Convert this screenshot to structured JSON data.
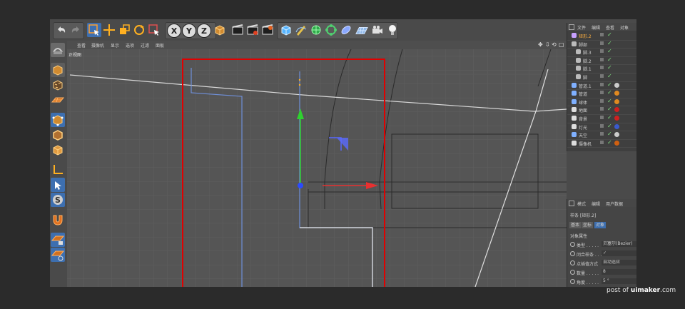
{
  "toolbar": {
    "undo_icon": "undo-icon",
    "redo_icon": "redo-icon",
    "x_label": "X",
    "y_label": "Y",
    "z_label": "Z"
  },
  "viewport": {
    "menu": [
      "查看",
      "摄像机",
      "显示",
      "选项",
      "过滤",
      "面板"
    ],
    "label": "正视图",
    "controls": [
      "✥",
      "⇩",
      "⟲",
      "▢"
    ]
  },
  "object_manager": {
    "tabs": [
      "文件",
      "编辑",
      "查看",
      "对象"
    ],
    "rows": [
      {
        "name": "矩形.2",
        "indent": 0,
        "icon": "spline-icon",
        "color": "#c8a0ff",
        "highlight": true,
        "tag": ""
      },
      {
        "name": "脚部",
        "indent": 0,
        "icon": "null-icon",
        "color": "#bbbbbb",
        "highlight": false,
        "tag": ""
      },
      {
        "name": "脚.3",
        "indent": 1,
        "icon": "null-icon",
        "color": "#bbbbbb",
        "highlight": false,
        "tag": ""
      },
      {
        "name": "脚.2",
        "indent": 1,
        "icon": "null-icon",
        "color": "#bbbbbb",
        "highlight": false,
        "tag": ""
      },
      {
        "name": "脚.1",
        "indent": 1,
        "icon": "null-icon",
        "color": "#bbbbbb",
        "highlight": false,
        "tag": ""
      },
      {
        "name": "脚",
        "indent": 1,
        "icon": "null-icon",
        "color": "#bbbbbb",
        "highlight": false,
        "tag": ""
      },
      {
        "name": "管道.1",
        "indent": 0,
        "icon": "sweep-icon",
        "color": "#7fb0ff",
        "highlight": false,
        "tag": "checker"
      },
      {
        "name": "管道",
        "indent": 0,
        "icon": "tube-icon",
        "color": "#7fb0ff",
        "highlight": false,
        "tag": "orange"
      },
      {
        "name": "球体",
        "indent": 0,
        "icon": "sphere-icon",
        "color": "#7fb0ff",
        "highlight": false,
        "tag": "orange"
      },
      {
        "name": "地面",
        "indent": 0,
        "icon": "floor-icon",
        "color": "#dddddd",
        "highlight": false,
        "tag": "red"
      },
      {
        "name": "背景",
        "indent": 0,
        "icon": "background-icon",
        "color": "#dddddd",
        "highlight": false,
        "tag": "red"
      },
      {
        "name": "灯光",
        "indent": 0,
        "icon": "light-icon",
        "color": "#dddddd",
        "highlight": false,
        "tag": "blue"
      },
      {
        "name": "天空",
        "indent": 0,
        "icon": "sky-icon",
        "color": "#7fb0ff",
        "highlight": false,
        "tag": "checker"
      },
      {
        "name": "摄像机",
        "indent": 0,
        "icon": "camera-icon",
        "color": "#dddddd",
        "highlight": false,
        "tag": "no"
      }
    ]
  },
  "attributes": {
    "tabs": [
      "模式",
      "编辑",
      "用户数据"
    ],
    "title": "样条 [矩形.2]",
    "sub_tabs": [
      "基本",
      "坐标",
      "对象"
    ],
    "section": "对象属性",
    "fields": [
      {
        "label": "类型 . . . . .",
        "value": "贝塞尔(Bezier)"
      },
      {
        "label": "闭合样条 . . .",
        "value": "✓"
      },
      {
        "label": "点插值方式",
        "value": "自动适应"
      },
      {
        "label": "数量 . . . . .",
        "value": "8"
      },
      {
        "label": "角度 . . . . .",
        "value": "5 °"
      }
    ]
  },
  "watermark": {
    "prefix": "post of ",
    "site": "uimaker",
    "suffix": ".com"
  },
  "colors": {
    "selection_frame": "#e00000",
    "spline": "#6f8fd8",
    "y_axis": "#2fd12f",
    "x_axis": "#e83030",
    "origin": "#2b4bff"
  }
}
